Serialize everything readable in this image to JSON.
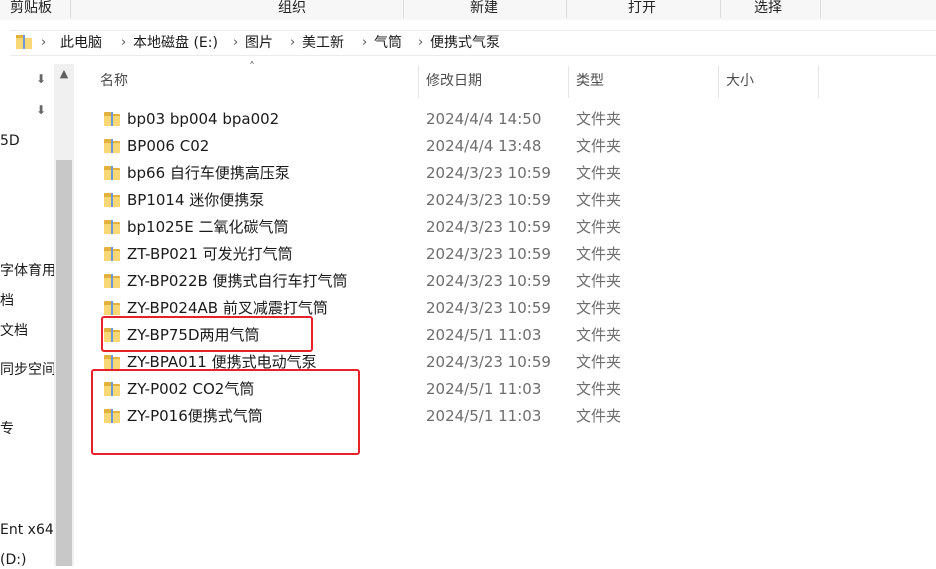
{
  "ribbon": {
    "groups": [
      "剪贴板",
      "组织",
      "新建",
      "打开",
      "选择"
    ]
  },
  "address": {
    "crumbs": [
      "此电脑",
      "本地磁盘 (E:)",
      "图片",
      "美工新",
      "气筒",
      "便携式气泵"
    ]
  },
  "nav": {
    "partial_items": [
      "5D",
      "字体育用",
      "档",
      "文档",
      "同步空间",
      "专",
      "Ent x64",
      "(D:)"
    ]
  },
  "columns": {
    "name": "名称",
    "modified": "修改日期",
    "type": "类型",
    "size": "大小"
  },
  "rows": [
    {
      "name": "bp03 bp004 bpa002",
      "modified": "2024/4/4 14:50",
      "type": "文件夹"
    },
    {
      "name": "BP006 C02",
      "modified": "2024/4/4 13:48",
      "type": "文件夹"
    },
    {
      "name": "bp66 自行车便携高压泵",
      "modified": "2024/3/23 10:59",
      "type": "文件夹"
    },
    {
      "name": "BP1014 迷你便携泵",
      "modified": "2024/3/23 10:59",
      "type": "文件夹"
    },
    {
      "name": "bp1025E 二氧化碳气筒",
      "modified": "2024/3/23 10:59",
      "type": "文件夹"
    },
    {
      "name": "ZT-BP021 可发光打气筒",
      "modified": "2024/3/23 10:59",
      "type": "文件夹"
    },
    {
      "name": "ZY-BP022B 便携式自行车打气筒",
      "modified": "2024/3/23 10:59",
      "type": "文件夹"
    },
    {
      "name": "ZY-BP024AB 前叉减震打气筒",
      "modified": "2024/3/23 10:59",
      "type": "文件夹"
    },
    {
      "name": "ZY-BP75D两用气筒",
      "modified": "2024/5/1 11:03",
      "type": "文件夹"
    },
    {
      "name": "ZY-BPA011 便携式电动气泵",
      "modified": "2024/3/23 10:59",
      "type": "文件夹"
    },
    {
      "name": "ZY-P002 CO2气筒",
      "modified": "2024/5/1 11:03",
      "type": "文件夹"
    },
    {
      "name": "ZY-P016便携式气筒",
      "modified": "2024/5/1 11:03",
      "type": "文件夹"
    }
  ],
  "colors": {
    "annotation": "#e8202a",
    "folder": "#f8d774"
  }
}
